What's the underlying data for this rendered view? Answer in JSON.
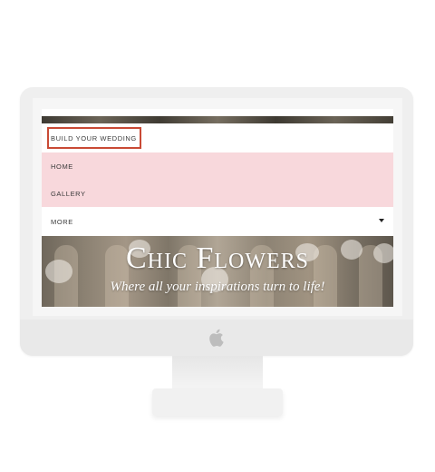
{
  "nav": {
    "items": [
      {
        "label": "BUILD YOUR WEDDING"
      },
      {
        "label": "HOME"
      },
      {
        "label": "GALLERY"
      },
      {
        "label": "MORE"
      }
    ]
  },
  "hero": {
    "title": "Chic Flowers",
    "subtitle": "Where all your inspirations turn to life!"
  },
  "colors": {
    "nav_highlight": "#f8d8dc",
    "focus_outline": "#c94a35"
  },
  "icons": {
    "more_dropdown": "caret-down-icon",
    "apple_logo": "apple-icon"
  }
}
